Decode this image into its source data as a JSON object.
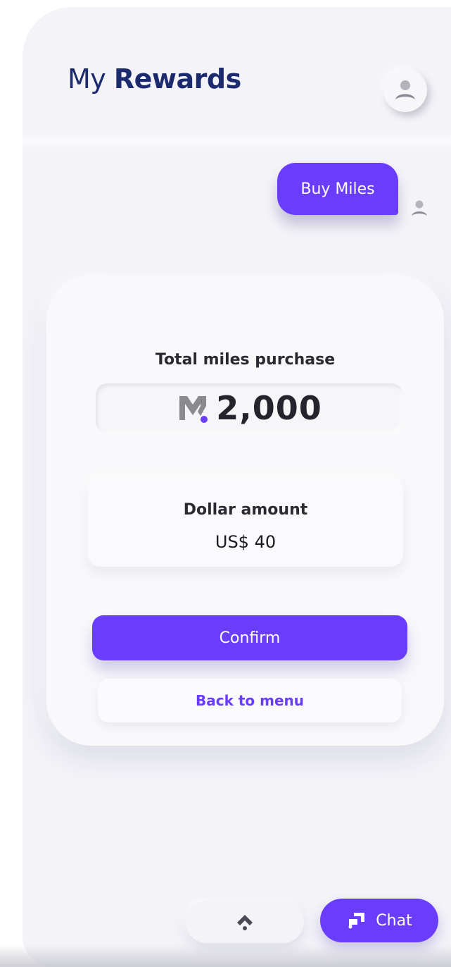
{
  "header": {
    "title_light": "My",
    "title_bold": "Rewards"
  },
  "chat": {
    "user_message": "Buy Miles"
  },
  "purchase_card": {
    "miles_label": "Total miles purchase",
    "miles_value": "2,000",
    "dollar_label": "Dollar amount",
    "dollar_value": "US$ 40",
    "confirm_label": "Confirm",
    "back_label": "Back to menu"
  },
  "bottom_bar": {
    "chat_label": "Chat"
  },
  "icons": {
    "profile": "user-avatar-icon",
    "miles": "miles-logo-icon",
    "scroll_up": "chevron-up-icon",
    "chat": "chat-bubble-icon"
  },
  "colors": {
    "accent": "#6a3dfc",
    "title": "#1c2a6e",
    "background": "#f3f3f8"
  }
}
